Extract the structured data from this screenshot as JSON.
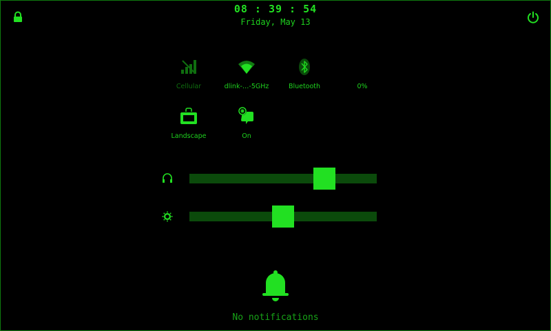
{
  "header": {
    "time": "08 : 39 : 54",
    "date": "Friday, May 13"
  },
  "quick_tiles": [
    {
      "label": "Cellular",
      "icon": "cellular-signal-icon",
      "active": false
    },
    {
      "label": "dlink-…-5GHz",
      "icon": "wifi-icon",
      "active": true
    },
    {
      "label": "Bluetooth",
      "icon": "bluetooth-icon",
      "active": true
    },
    {
      "label": "0%",
      "icon": "battery-icon",
      "active": true
    },
    {
      "label": "Landscape",
      "icon": "screen-rotation-icon",
      "active": true
    },
    {
      "label": "On",
      "icon": "data-saver-icon",
      "active": true
    }
  ],
  "sliders": {
    "volume": {
      "icon": "headphones-icon",
      "value_fraction": 0.75
    },
    "brightness": {
      "icon": "brightness-icon",
      "value_fraction": 0.5
    }
  },
  "notifications": {
    "empty_text": "No notifications",
    "icon": "bell-icon"
  },
  "colors": {
    "accent": "#22e022",
    "dim": "#0f6e0f",
    "track": "#0b4a0b",
    "background": "#000000"
  }
}
